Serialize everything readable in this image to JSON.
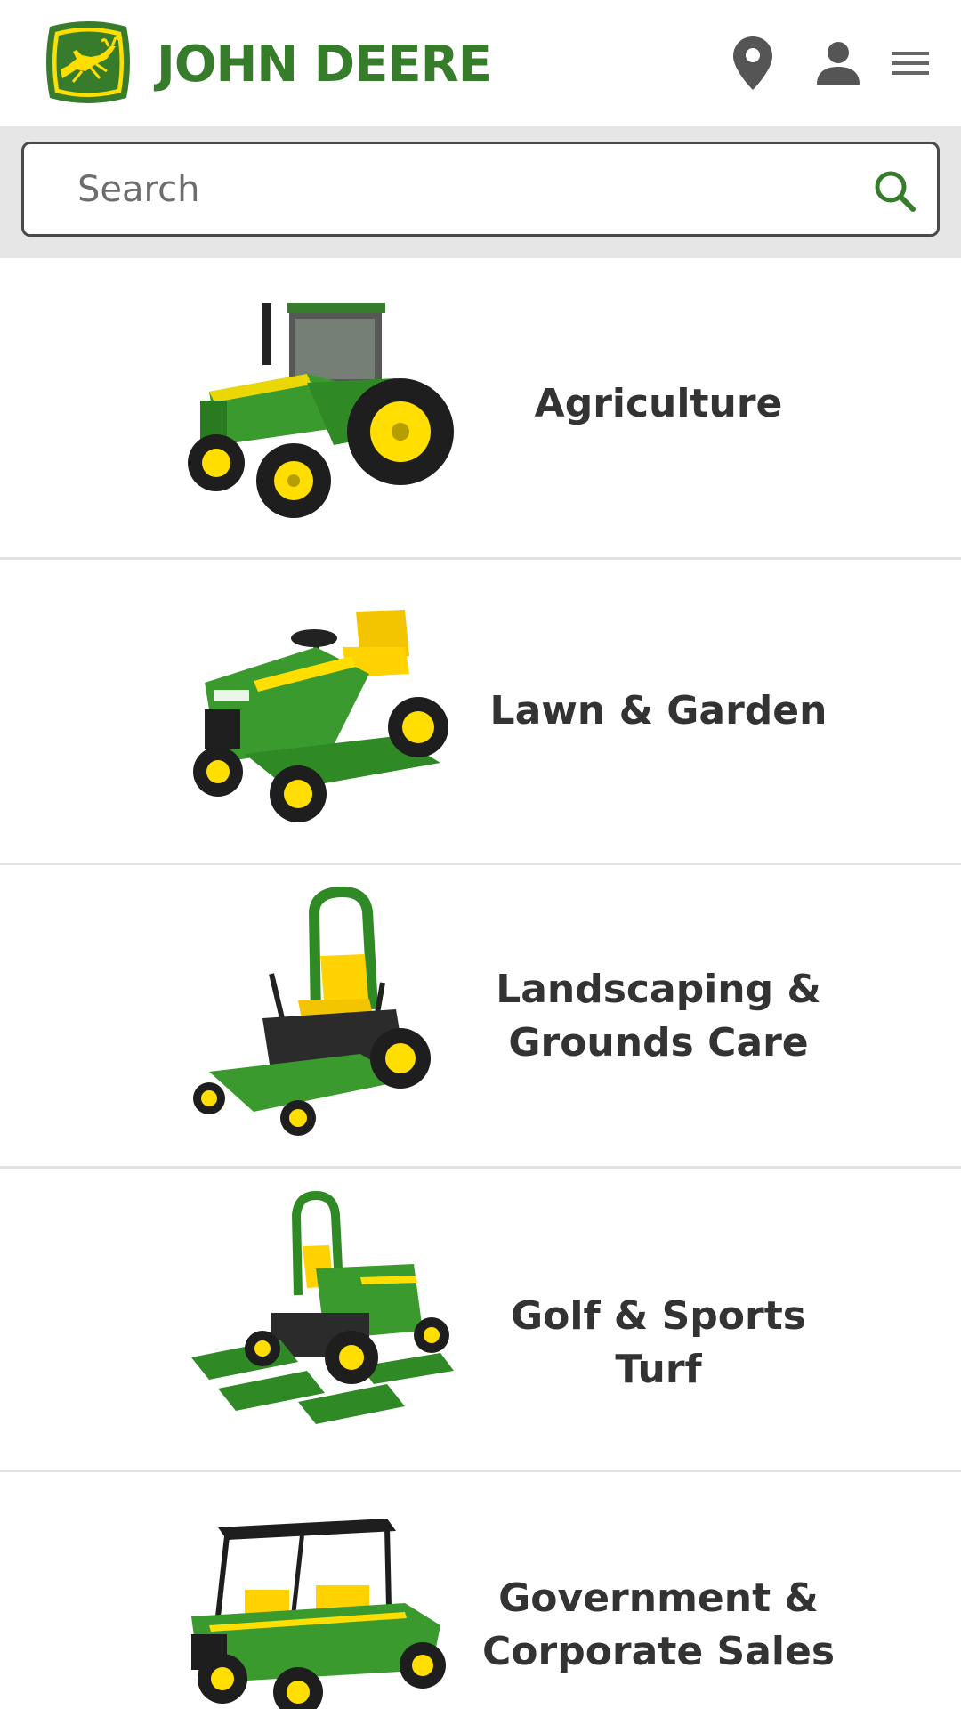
{
  "brand": {
    "name": "JOHN DEERE",
    "name_first": "John",
    "name_second": "Deere",
    "colors": {
      "green": "#367c2b",
      "yellow": "#ffde00"
    }
  },
  "header_icons": [
    "location-pin-icon",
    "user-icon",
    "menu-icon"
  ],
  "search": {
    "placeholder": "Search",
    "value": ""
  },
  "categories": [
    {
      "line1": "Agriculture",
      "line2": ""
    },
    {
      "line1": "Lawn & Garden",
      "line2": ""
    },
    {
      "line1": "Landscaping &",
      "line2": "Grounds Care"
    },
    {
      "line1": "Golf & Sports Turf",
      "line2": ""
    },
    {
      "line1": "Government &",
      "line2": "Corporate Sales"
    }
  ]
}
